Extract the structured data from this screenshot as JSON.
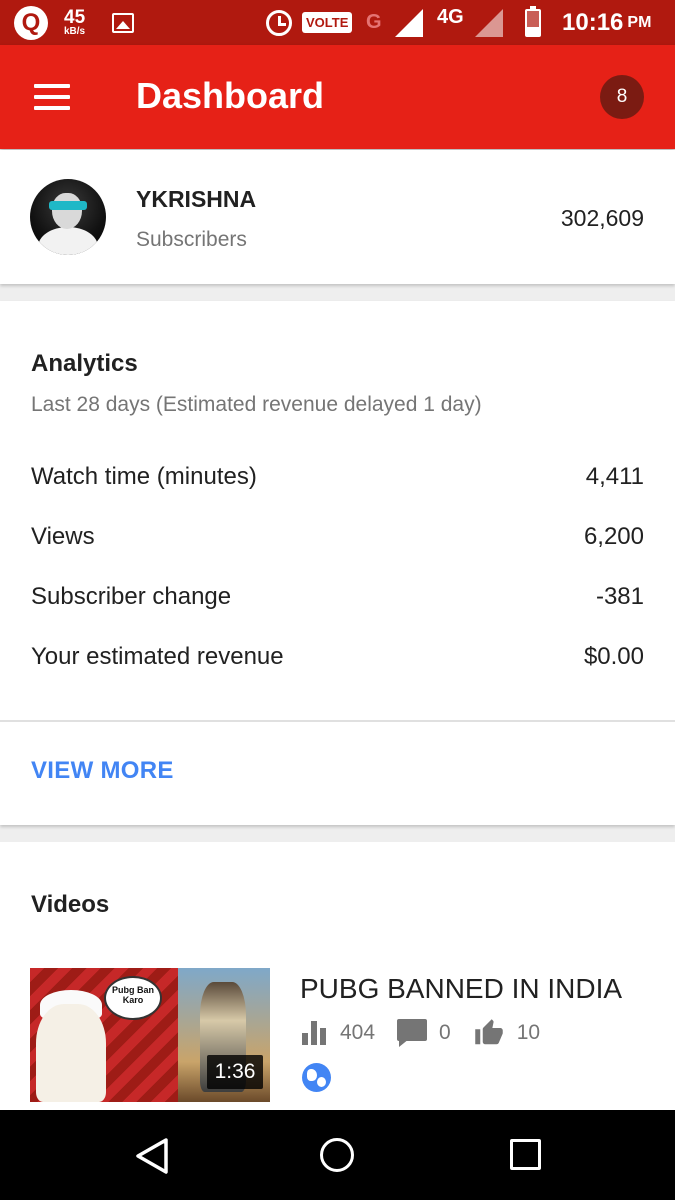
{
  "status_bar": {
    "speed_value": "45",
    "speed_unit": "kB/s",
    "volte_label": "VOLTE",
    "network_g": "G",
    "network_type": "4G",
    "time": "10:16",
    "ampm": "PM"
  },
  "app_bar": {
    "title": "Dashboard",
    "notification_count": "8"
  },
  "channel": {
    "name": "YKRISHNA",
    "subscribers_label": "Subscribers",
    "subscribers_count": "302,609"
  },
  "analytics": {
    "title": "Analytics",
    "subtitle": "Last 28 days (Estimated revenue delayed 1 day)",
    "rows": [
      {
        "label": "Watch time (minutes)",
        "value": "4,411"
      },
      {
        "label": "Views",
        "value": "6,200"
      },
      {
        "label": "Subscriber change",
        "value": "-381"
      },
      {
        "label": "Your estimated revenue",
        "value": "$0.00"
      }
    ],
    "view_more": "VIEW MORE"
  },
  "videos": {
    "title": "Videos",
    "items": [
      {
        "title": "PUBG BANNED IN INDIA",
        "thumbnail_text": "Pubg Ban Karo",
        "duration": "1:36",
        "views": "404",
        "comments": "0",
        "likes": "10",
        "visibility_icon": "globe-icon"
      }
    ]
  },
  "colors": {
    "status_bar": "#b0190f",
    "app_bar": "#e62117",
    "badge": "#7b1b12",
    "link": "#4285f4"
  }
}
